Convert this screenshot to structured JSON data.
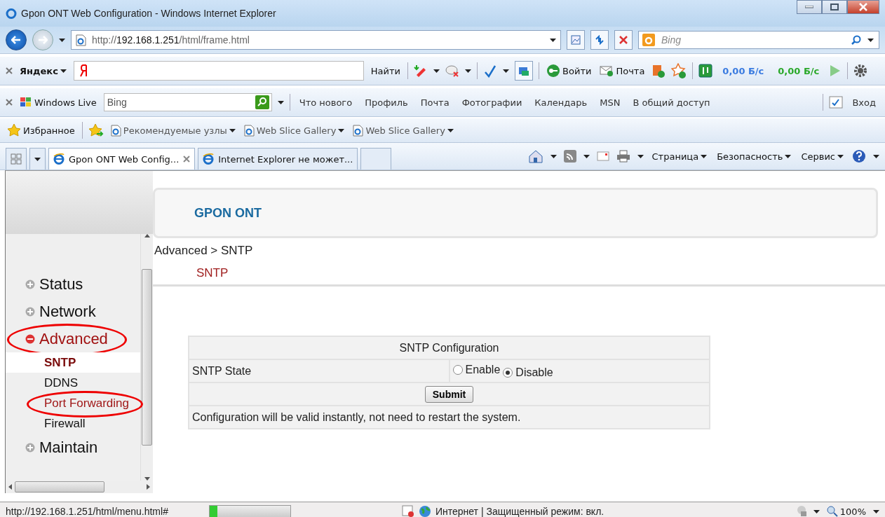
{
  "window": {
    "title": "Gpon ONT Web Configuration - Windows Internet Explorer"
  },
  "address_bar": {
    "url_prefix": "http://",
    "url_host": "192.168.1.251",
    "url_path": "/html/frame.html",
    "search_placeholder": "Bing"
  },
  "yandex_toolbar": {
    "brand": "Яндекс",
    "search_button": "Найти",
    "login": "Войти",
    "mail": "Почта",
    "speeds": [
      {
        "text": "0,00 Б/с",
        "color": "#3a7be0"
      },
      {
        "text": "0,00 Б/с",
        "color": "#2aa82a"
      }
    ]
  },
  "live_toolbar": {
    "brand": "Windows Live",
    "search_placeholder": "Bing",
    "links": [
      "Что нового",
      "Профиль",
      "Почта",
      "Фотографии",
      "Календарь",
      "MSN",
      "В общий доступ"
    ],
    "login": "Вход"
  },
  "favorites_bar": {
    "label": "Избранное",
    "links": [
      "Рекомендуемые узлы",
      "Web Slice Gallery",
      "Web Slice Gallery"
    ]
  },
  "tabs": [
    {
      "label": "Gpon ONT Web Config...",
      "selected": true
    },
    {
      "label": "Internet Explorer не может...",
      "selected": false
    }
  ],
  "command_bar": [
    "Страница",
    "Безопасность",
    "Сервис"
  ],
  "page": {
    "header": "GPON ONT",
    "breadcrumb": "Advanced > SNTP",
    "section_title": "SNTP",
    "menu": [
      {
        "label": "Status",
        "expanded": false,
        "circled": false
      },
      {
        "label": "Network",
        "expanded": false,
        "circled": false
      },
      {
        "label": "Advanced",
        "expanded": true,
        "circled": true,
        "children": [
          {
            "label": "SNTP",
            "selected": true,
            "hovered": false,
            "circled": false
          },
          {
            "label": "DDNS",
            "selected": false,
            "hovered": false,
            "circled": false
          },
          {
            "label": "Port Forwarding",
            "selected": false,
            "hovered": true,
            "circled": true
          },
          {
            "label": "Firewall",
            "selected": false,
            "hovered": false,
            "circled": false
          }
        ]
      },
      {
        "label": "Maintain",
        "expanded": false,
        "circled": false
      }
    ],
    "form": {
      "title": "SNTP Configuration",
      "field_label": "SNTP State",
      "options": [
        {
          "label": "Enable",
          "selected": false
        },
        {
          "label": "Disable",
          "selected": true
        }
      ],
      "submit": "Submit",
      "note": "Configuration will be valid instantly, not need to restart the system."
    }
  },
  "status_bar": {
    "url": "http://192.168.1.251/html/menu.html#",
    "level": 0.1,
    "zone": "Интернет | Защищенный режим: вкл.",
    "zoom": "100%"
  }
}
